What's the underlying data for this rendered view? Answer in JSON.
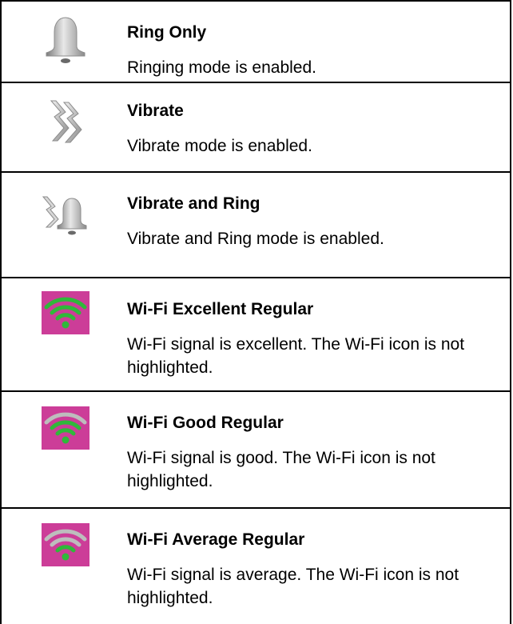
{
  "rows": [
    {
      "icon": "bell-icon",
      "title": "Ring Only",
      "description": "Ringing mode is enabled."
    },
    {
      "icon": "vibrate-icon",
      "title": "Vibrate",
      "description": "Vibrate mode is enabled."
    },
    {
      "icon": "vibrate-bell-icon",
      "title": "Vibrate and Ring",
      "description": "Vibrate and Ring mode is enabled."
    },
    {
      "icon": "wifi-excellent-icon",
      "title": "Wi-Fi Excellent Regular",
      "description": "Wi-Fi signal is excellent. The Wi-Fi icon is not highlighted."
    },
    {
      "icon": "wifi-good-icon",
      "title": "Wi-Fi Good Regular",
      "description": "Wi-Fi signal is good. The Wi-Fi icon is not highlighted."
    },
    {
      "icon": "wifi-average-icon",
      "title": "Wi-Fi Average Regular",
      "description": "Wi-Fi signal is average. The Wi-Fi icon is not highlighted."
    }
  ],
  "colors": {
    "wifi_background": "#cc3d98",
    "wifi_active": "#2fb83a",
    "wifi_inactive": "#bdbdbd",
    "icon_gray": "#9a9a9a"
  }
}
